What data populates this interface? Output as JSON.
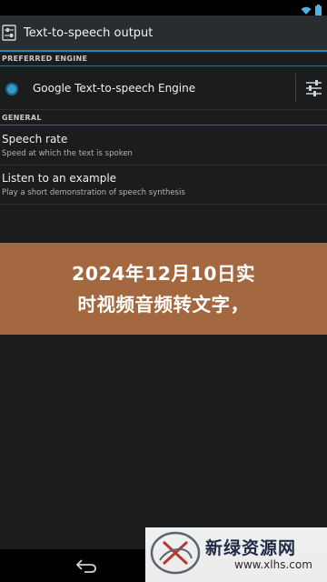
{
  "status_bar": {
    "icons": [
      "wifi-icon",
      "battery-icon"
    ]
  },
  "action_bar": {
    "title": "Text-to-speech output",
    "icon": "tts-settings-icon"
  },
  "sections": {
    "preferred_engine": "PREFERRED ENGINE",
    "general": "GENERAL"
  },
  "engine": {
    "label": "Google Text-to-speech Engine",
    "selected": true
  },
  "prefs": [
    {
      "title": "Speech rate",
      "summary": "Speed at which the text is spoken"
    },
    {
      "title": "Listen to an example",
      "summary": "Play a short demonstration of speech synthesis"
    }
  ],
  "banner": {
    "line1": "2024年12月10日实",
    "line2": "时视频音频转文字，"
  },
  "watermark": {
    "name": "新绿资源网",
    "url": "www.xlhs.com"
  },
  "colors": {
    "accent": "#1e8ab7",
    "banner": "#a3683f",
    "radio": "#2f9bd2"
  }
}
